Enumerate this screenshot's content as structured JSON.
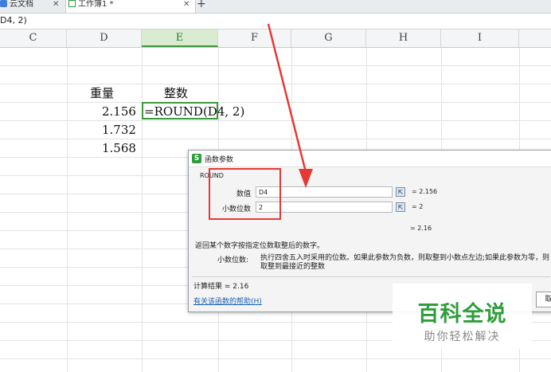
{
  "tabs": {
    "cloud_label": "云文档",
    "workbook_label": "工作簿1 *",
    "add_label": "+"
  },
  "formula_bar": {
    "text": "D4, 2)"
  },
  "columns": [
    "C",
    "D",
    "E",
    "F",
    "G",
    "H",
    "I"
  ],
  "selected_column": "E",
  "cells": {
    "d_header": "重量",
    "e_header": "整数",
    "d4": "2.156",
    "e4": "=ROUND(D4, 2)",
    "d5": "1.732",
    "d6": "1.568"
  },
  "dialog": {
    "title": "函数参数",
    "function_name": "ROUND",
    "params": [
      {
        "label": "数值",
        "value": "D4",
        "result": "= 2.156"
      },
      {
        "label": "小数位数",
        "value": "2",
        "result": "= 2"
      }
    ],
    "total": "= 2.16",
    "description": "返回某个数字按指定位数取整后的数字。",
    "param_desc_label": "小数位数:",
    "param_desc": "执行四舍五入时采用的位数。如果此参数为负数，则取整到小数点左边;如果此参数为零，则取整到最接近的整数",
    "calc_result": "计算结果 = 2.16",
    "help_link": "有关该函数的帮助(H)",
    "button_label": "取"
  },
  "watermark": {
    "title": "百科全说",
    "subtitle": "助你轻松解决"
  },
  "colors": {
    "accent_green": "#3c9a3c",
    "highlight_red": "#e53935",
    "link_blue": "#1a5fb4"
  }
}
